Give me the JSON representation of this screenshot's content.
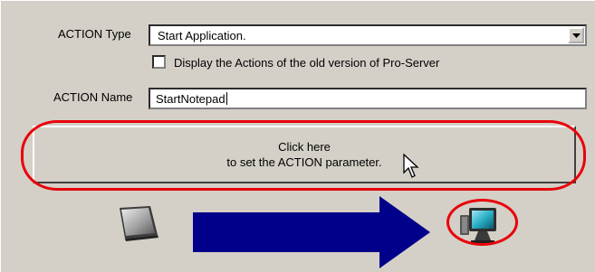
{
  "action_type": {
    "label": "ACTION Type",
    "selected": "Start Application."
  },
  "old_version_checkbox": {
    "label": "Display the Actions of the old version of Pro-Server",
    "checked": false
  },
  "action_name": {
    "label": "ACTION Name",
    "value": "StartNotepad"
  },
  "parameter_button": {
    "line1": "Click here",
    "line2": "to set the ACTION parameter."
  },
  "icons": {
    "dropdown": "chevron-down-icon",
    "cursor": "mouse-pointer-icon",
    "source": "display-panel-icon",
    "target": "pc-monitor-icon",
    "flow": "right-arrow-icon"
  },
  "colors": {
    "highlight": "#e8000a",
    "arrow": "#00008b",
    "panel": "#d4d0c8"
  }
}
